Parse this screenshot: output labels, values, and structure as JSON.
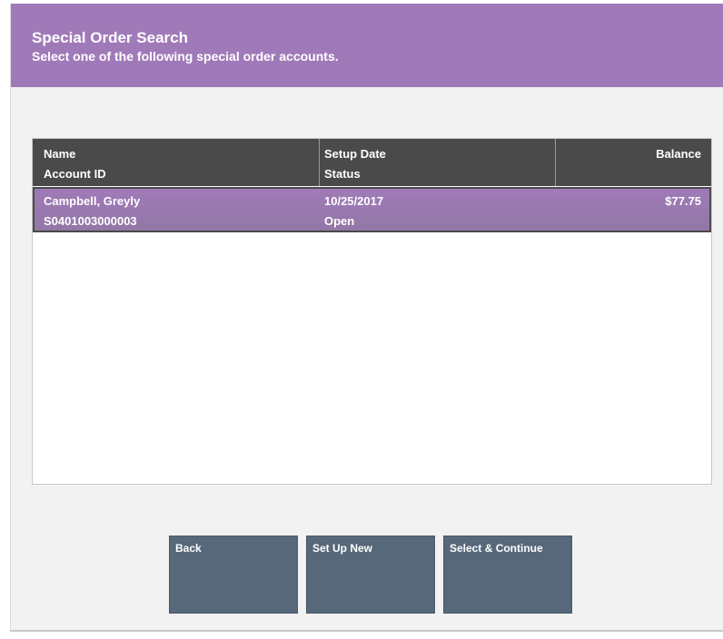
{
  "header": {
    "title": "Special Order Search",
    "subtitle": "Select one of the following special order accounts."
  },
  "table": {
    "columns": {
      "col1_line1": "Name",
      "col1_line2": "Account ID",
      "col2_line1": "Setup Date",
      "col2_line2": "Status",
      "col3_line1": "Balance"
    },
    "rows": [
      {
        "name": "Campbell, Greyly",
        "account_id": "S0401003000003",
        "setup_date": "10/25/2017",
        "status": "Open",
        "balance": "$77.75"
      }
    ]
  },
  "buttons": {
    "back": "Back",
    "setup_new": "Set Up New",
    "select_continue": "Select & Continue"
  },
  "colors": {
    "header": "#a07ab8",
    "selected_row": "#a07ab8",
    "table_header": "#4a4a4a",
    "button": "#56687a"
  }
}
